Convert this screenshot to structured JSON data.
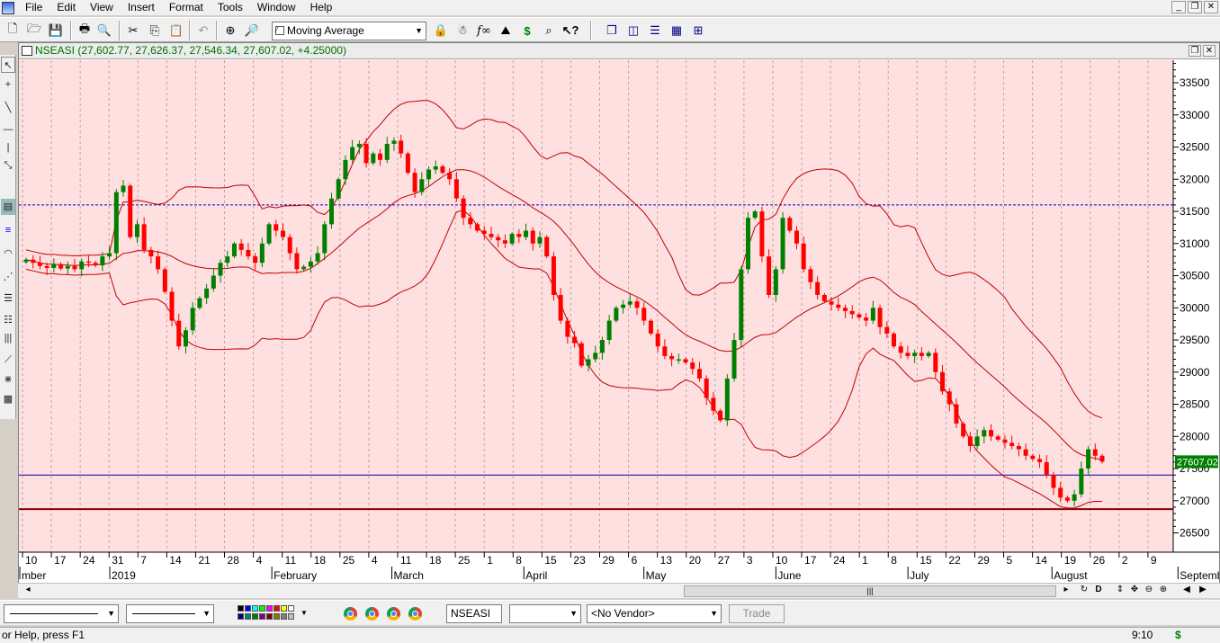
{
  "menu": {
    "items": [
      "File",
      "Edit",
      "View",
      "Insert",
      "Format",
      "Tools",
      "Window",
      "Help"
    ]
  },
  "toolbar": {
    "indicator_combo": "Moving Average",
    "dollar_icon": "$"
  },
  "chart": {
    "title": "NSEASI (27,602.77, 27,626.37, 27,546.34, 27,607.02, +4.25000)",
    "last_price_label": "27607.02",
    "colors": {
      "background": "#ffe0e0",
      "bull": "#008000",
      "bear": "#ff0000",
      "band": "#c00000",
      "price_label_bg": "#008000"
    }
  },
  "chart_data": {
    "type": "candlestick",
    "ylim": [
      26200,
      33850
    ],
    "y_ticks": [
      26500,
      27000,
      27500,
      28000,
      28500,
      29000,
      29500,
      30000,
      30500,
      31000,
      31500,
      32000,
      32500,
      33000,
      33500
    ],
    "x_day_labels": [
      "10",
      "17",
      "24",
      "31",
      "7",
      "14",
      "21",
      "28",
      "4",
      "11",
      "18",
      "25",
      "4",
      "11",
      "18",
      "25",
      "1",
      "8",
      "15",
      "23",
      "29",
      "6",
      "13",
      "20",
      "27",
      "3",
      "10",
      "17",
      "24",
      "1",
      "8",
      "15",
      "22",
      "29",
      "5",
      "14",
      "19",
      "26",
      "2",
      "9"
    ],
    "x_month_labels": [
      "mber",
      "2019",
      "February",
      "March",
      "April",
      "May",
      "June",
      "July",
      "August",
      "September"
    ],
    "reference_lines": [
      {
        "value": 31600,
        "style": "dashed",
        "color": "#0000cc"
      },
      {
        "value": 27400,
        "style": "solid",
        "color": "#0000aa"
      },
      {
        "value": 26870,
        "style": "solid",
        "color": "#8b0000"
      }
    ],
    "close": [
      30750,
      30700,
      30650,
      30620,
      30680,
      30610,
      30650,
      30600,
      30720,
      30700,
      30660,
      30800,
      30850,
      31800,
      31900,
      31100,
      31300,
      30900,
      30800,
      30600,
      30250,
      29800,
      29400,
      29650,
      30000,
      30150,
      30300,
      30500,
      30700,
      30800,
      31000,
      30900,
      30800,
      30700,
      31000,
      31300,
      31200,
      31100,
      30850,
      30600,
      30640,
      30720,
      30850,
      31300,
      31700,
      32000,
      32300,
      32500,
      32550,
      32250,
      32400,
      32300,
      32550,
      32600,
      32400,
      32100,
      31800,
      32000,
      32150,
      32200,
      32100,
      32000,
      31700,
      31400,
      31300,
      31200,
      31150,
      31100,
      31050,
      31000,
      31150,
      31100,
      31200,
      31000,
      31100,
      30800,
      30200,
      29800,
      29550,
      29450,
      29100,
      29200,
      29300,
      29500,
      29800,
      30000,
      30050,
      30100,
      30000,
      29800,
      29600,
      29400,
      29250,
      29200,
      29200,
      29150,
      29050,
      28900,
      28600,
      28400,
      28250,
      28900,
      29500,
      30600,
      31400,
      31500,
      30800,
      30200,
      30600,
      31400,
      31200,
      31000,
      30600,
      30400,
      30200,
      30100,
      30050,
      30000,
      29950,
      29900,
      29850,
      29800,
      30000,
      29700,
      29600,
      29400,
      29300,
      29250,
      29300,
      29250,
      29300,
      29000,
      28700,
      28500,
      28200,
      28000,
      27850,
      28000,
      28100,
      28000,
      27950,
      27900,
      27850,
      27800,
      27700,
      27650,
      27600,
      27400,
      27200,
      27050,
      27000,
      27100,
      27500,
      27800,
      27700,
      27607.02
    ]
  },
  "drawbar": {
    "symbol": "NSEASI",
    "vendor": "<No Vendor>",
    "trade": "Trade"
  },
  "status": {
    "help": "or Help, press F1",
    "time": "9:10",
    "dollar": "$"
  }
}
